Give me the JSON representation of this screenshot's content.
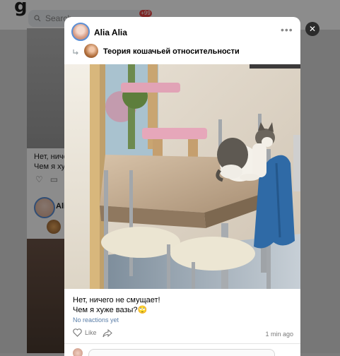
{
  "background": {
    "logo": "g",
    "search_placeholder": "Search",
    "notification_count": "+99",
    "partial_text_line1": "Нет, ничего",
    "partial_text_line2": "Чем я хуже",
    "partial_author": "Ali"
  },
  "post": {
    "author": "Alia Alia",
    "repost_source": "Теория кошачьей относительности",
    "text_line1": "Нет, ничего не смущает!",
    "text_line2": "Чем я хуже вазы?🙄",
    "reactions": "No reactions yet",
    "like_label": "Like",
    "time_ago": "1 min ago"
  },
  "icons": {
    "more": "more-icon",
    "repost": "repost-icon",
    "like": "heart-icon",
    "share": "share-icon",
    "close": "close-icon",
    "search": "search-icon"
  },
  "colors": {
    "accent": "#5a8fd6",
    "link": "#5a7ea8",
    "badge": "#e64646",
    "overlay": "rgba(0,0,0,0.45)"
  }
}
